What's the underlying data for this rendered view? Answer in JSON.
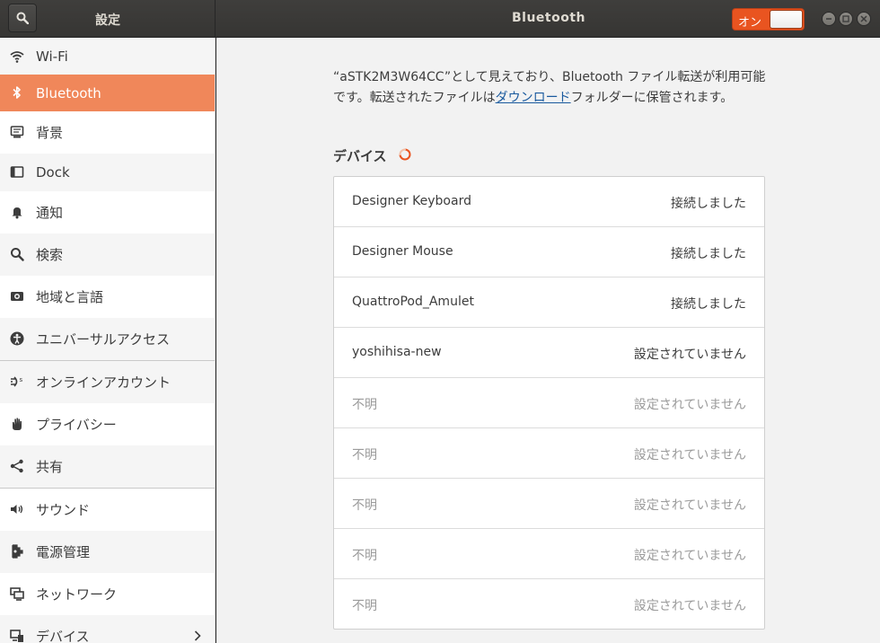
{
  "window": {
    "settings_title": "設定",
    "panel_title": "Bluetooth",
    "toggle_label": "オン"
  },
  "sidebar": {
    "items": [
      {
        "label": "Wi-Fi",
        "icon": "wifi-icon"
      },
      {
        "label": "Bluetooth",
        "icon": "bluetooth-icon"
      },
      {
        "label": "背景",
        "icon": "background-icon"
      },
      {
        "label": "Dock",
        "icon": "dock-icon"
      },
      {
        "label": "通知",
        "icon": "bell-icon"
      },
      {
        "label": "検索",
        "icon": "search-icon"
      },
      {
        "label": "地域と言語",
        "icon": "region-icon"
      },
      {
        "label": "ユニバーサルアクセス",
        "icon": "accessibility-icon"
      },
      {
        "label": "オンラインアカウント",
        "icon": "online-accounts-icon"
      },
      {
        "label": "プライバシー",
        "icon": "hand-icon"
      },
      {
        "label": "共有",
        "icon": "share-icon"
      },
      {
        "label": "サウンド",
        "icon": "speaker-icon"
      },
      {
        "label": "電源管理",
        "icon": "power-plug-icon"
      },
      {
        "label": "ネットワーク",
        "icon": "network-icon"
      },
      {
        "label": "デバイス",
        "icon": "devices-icon"
      }
    ]
  },
  "main": {
    "desc_before": "“aSTK2M3W64CC”として見えており、Bluetooth ファイル転送が利用可能です。転送されたファイルは",
    "desc_link": "ダウンロード",
    "desc_after": "フォルダーに保管されます。",
    "devices_heading": "デバイス",
    "devices": [
      {
        "name": "Designer Keyboard",
        "status": "接続しました"
      },
      {
        "name": "Designer Mouse",
        "status": "接続しました"
      },
      {
        "name": "QuattroPod_Amulet",
        "status": "接続しました"
      },
      {
        "name": "yoshihisa-new",
        "status": "設定されていません"
      },
      {
        "name": "不明",
        "status": "設定されていません"
      },
      {
        "name": "不明",
        "status": "設定されていません"
      },
      {
        "name": "不明",
        "status": "設定されていません"
      },
      {
        "name": "不明",
        "status": "設定されていません"
      },
      {
        "name": "不明",
        "status": "設定されていません"
      }
    ]
  },
  "colors": {
    "accent": "#e95420",
    "sidebar_active": "#f0875a",
    "link": "#1a5a9e"
  }
}
